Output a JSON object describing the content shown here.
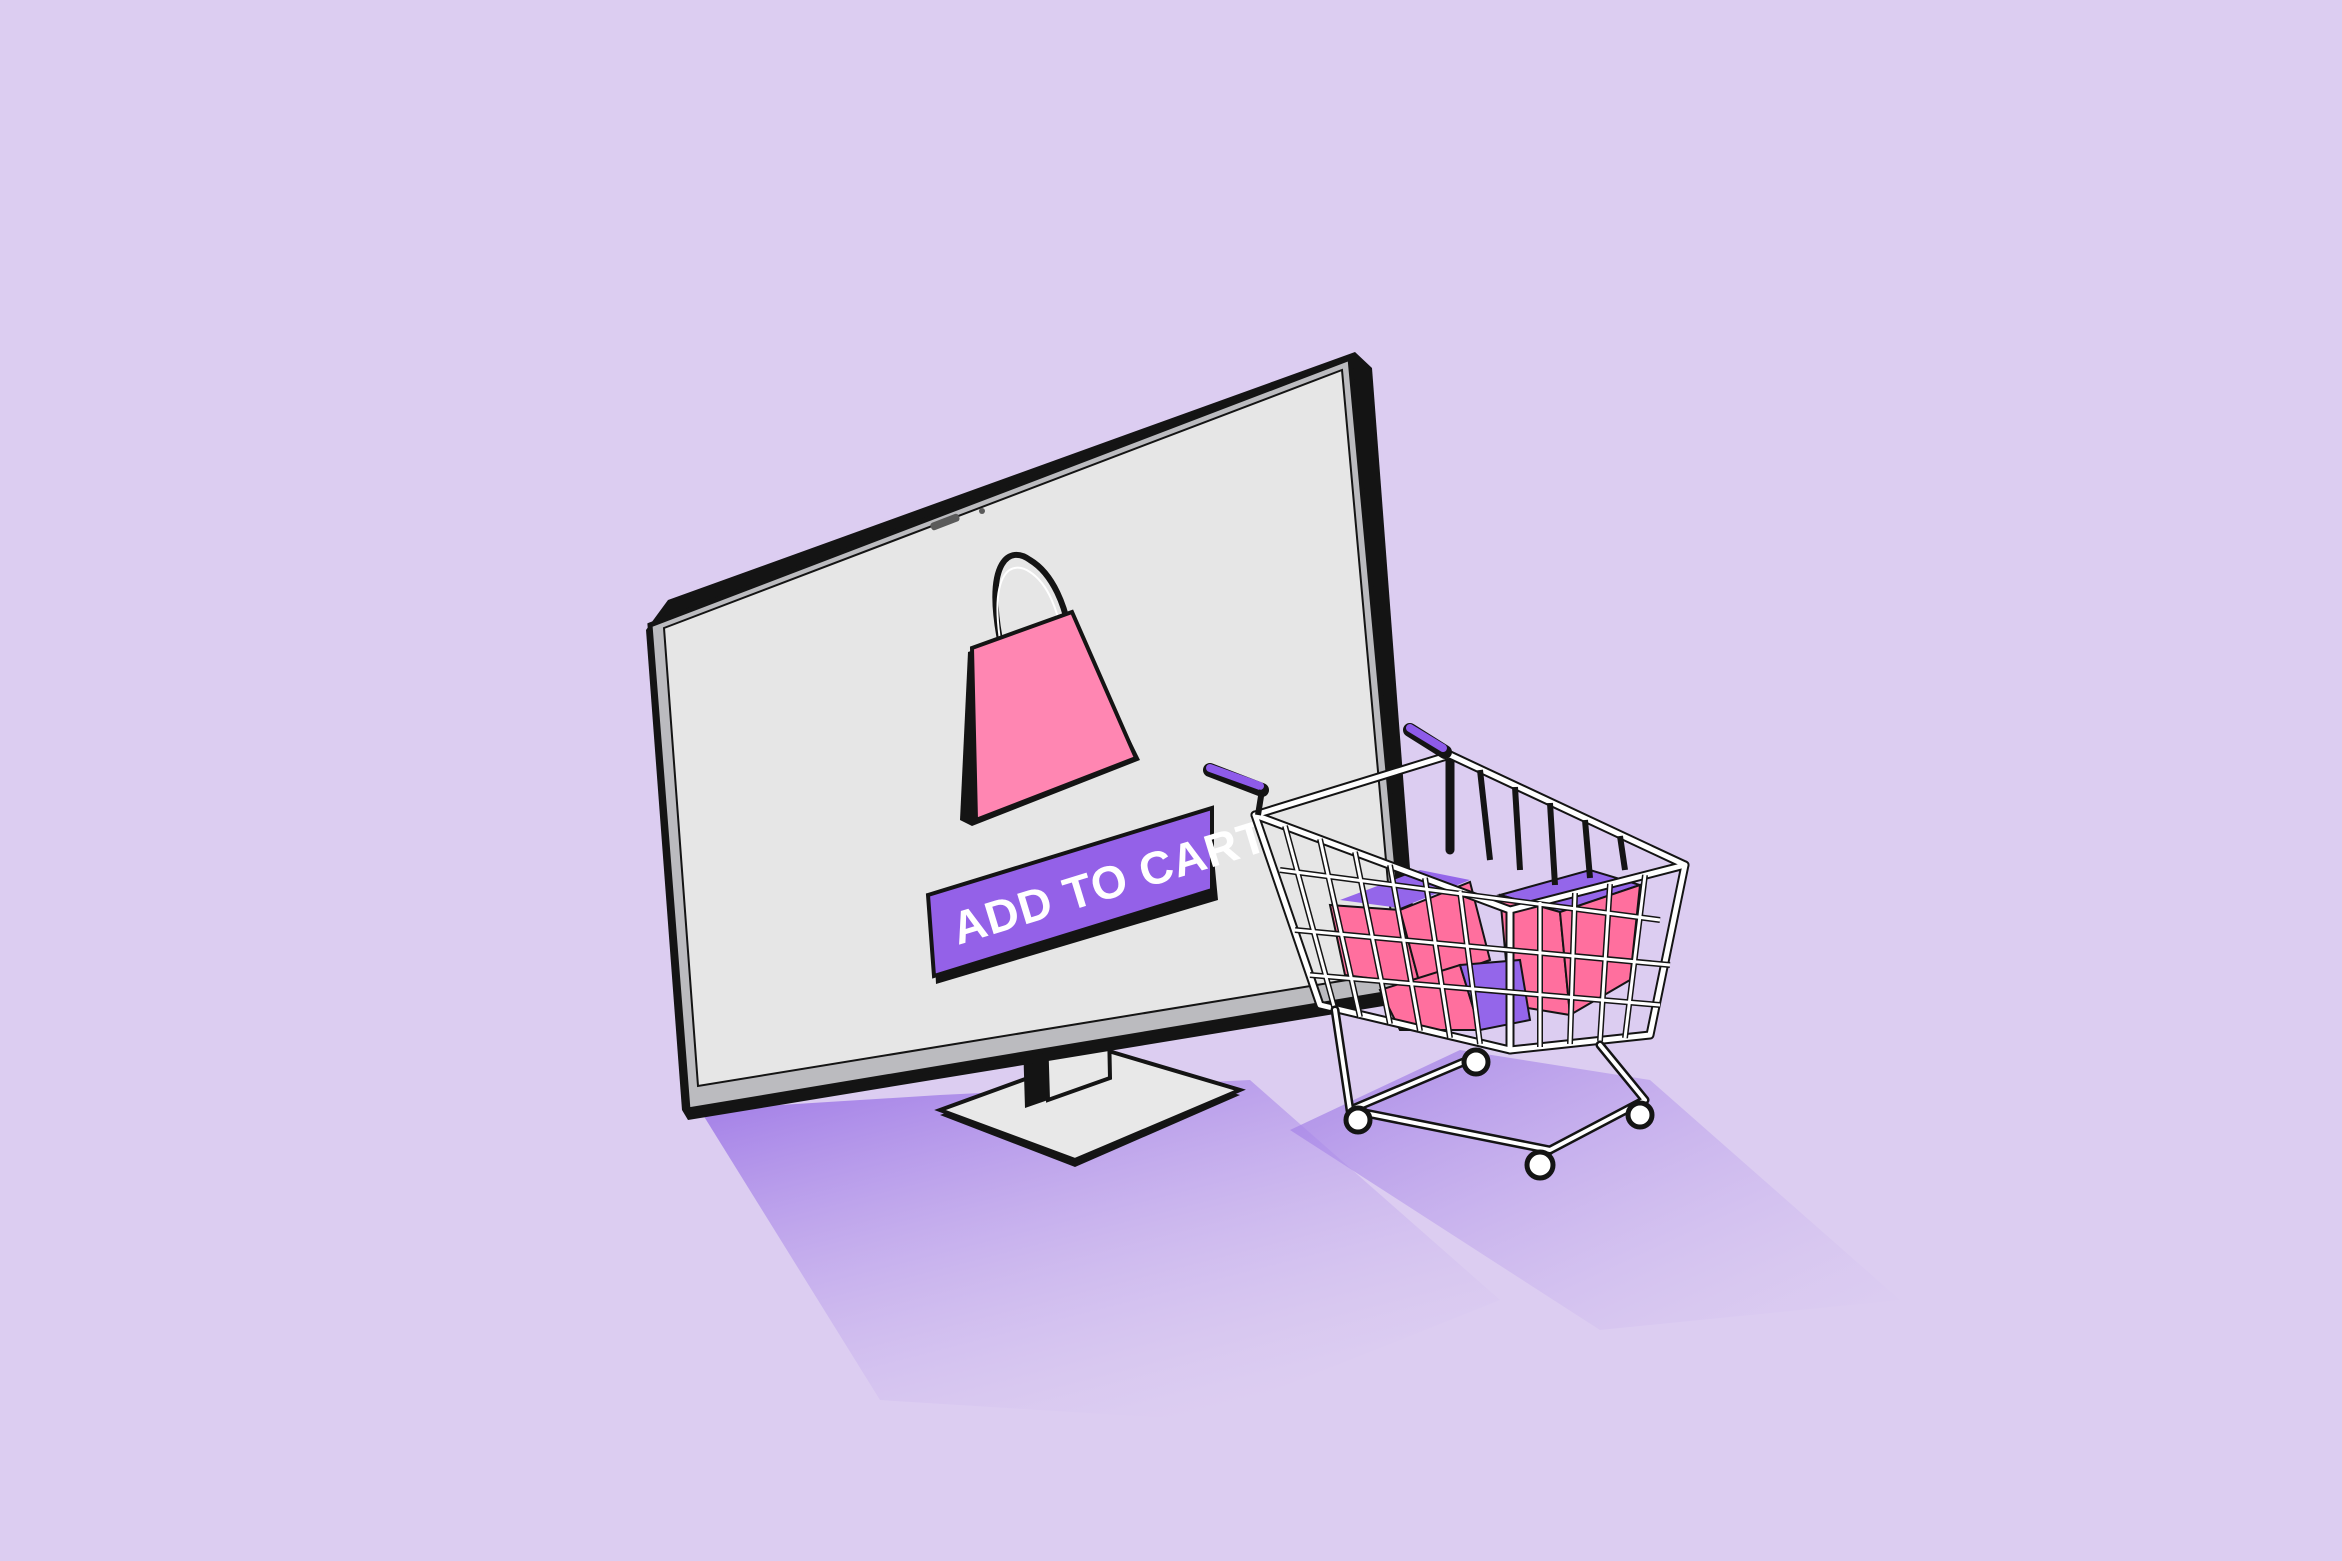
{
  "screen": {
    "button_label": "ADD TO CART"
  },
  "colors": {
    "background": "#DCCDF1",
    "shadow": "#A98BE3",
    "monitor_frame": "#1A1A1A",
    "monitor_screen": "#E6E6E6",
    "monitor_bezel": "#B9B9BD",
    "button": "#9461E8",
    "bag": "#FF86B2",
    "cart_frame": "#FFFFFF",
    "cart_handle": "#8E5BEA",
    "box_pink": "#FF6F9E",
    "box_purple": "#9466EA"
  },
  "icons": {
    "monitor": "desktop-monitor-icon",
    "bag": "shopping-bag-icon",
    "cart": "shopping-cart-icon"
  }
}
